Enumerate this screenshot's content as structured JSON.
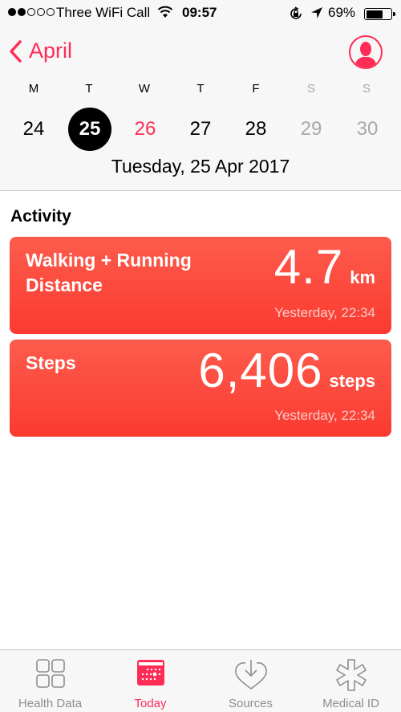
{
  "status_bar": {
    "signal_filled": 2,
    "signal_total": 5,
    "carrier": "Three WiFi Call",
    "time": "09:57",
    "battery_percent": "69%",
    "battery_level": 0.69,
    "icons": [
      "wifi-icon",
      "rotation-lock-icon",
      "location-arrow-icon",
      "battery-icon"
    ]
  },
  "header": {
    "back_label": "April",
    "weekdays": [
      "M",
      "T",
      "W",
      "T",
      "F",
      "S",
      "S"
    ],
    "days": [
      "24",
      "25",
      "26",
      "27",
      "28",
      "29",
      "30"
    ],
    "selected_day_index": 1,
    "today_index": 2,
    "date_title": "Tuesday, 25 Apr 2017"
  },
  "section": {
    "title": "Activity"
  },
  "cards": [
    {
      "label_line1": "Walking + Running",
      "label_line2": "Distance",
      "value": "4.7",
      "unit": "km",
      "time": "Yesterday, 22:34"
    },
    {
      "label_line1": "Steps",
      "value": "6,406",
      "unit": "steps",
      "time": "Yesterday, 22:34"
    }
  ],
  "tabbar": {
    "items": [
      {
        "label": "Health Data",
        "icon": "health-data-grid-icon"
      },
      {
        "label": "Today",
        "icon": "calendar-icon",
        "active": true
      },
      {
        "label": "Sources",
        "icon": "heart-download-icon"
      },
      {
        "label": "Medical ID",
        "icon": "medical-asterisk-icon"
      }
    ]
  },
  "colors": {
    "accent": "#ff2d55",
    "card_top": "#fd5c4d",
    "card_bottom": "#fb3a30",
    "inactive_gray": "#8e8e93",
    "weekend_gray": "#a8a8a8"
  }
}
